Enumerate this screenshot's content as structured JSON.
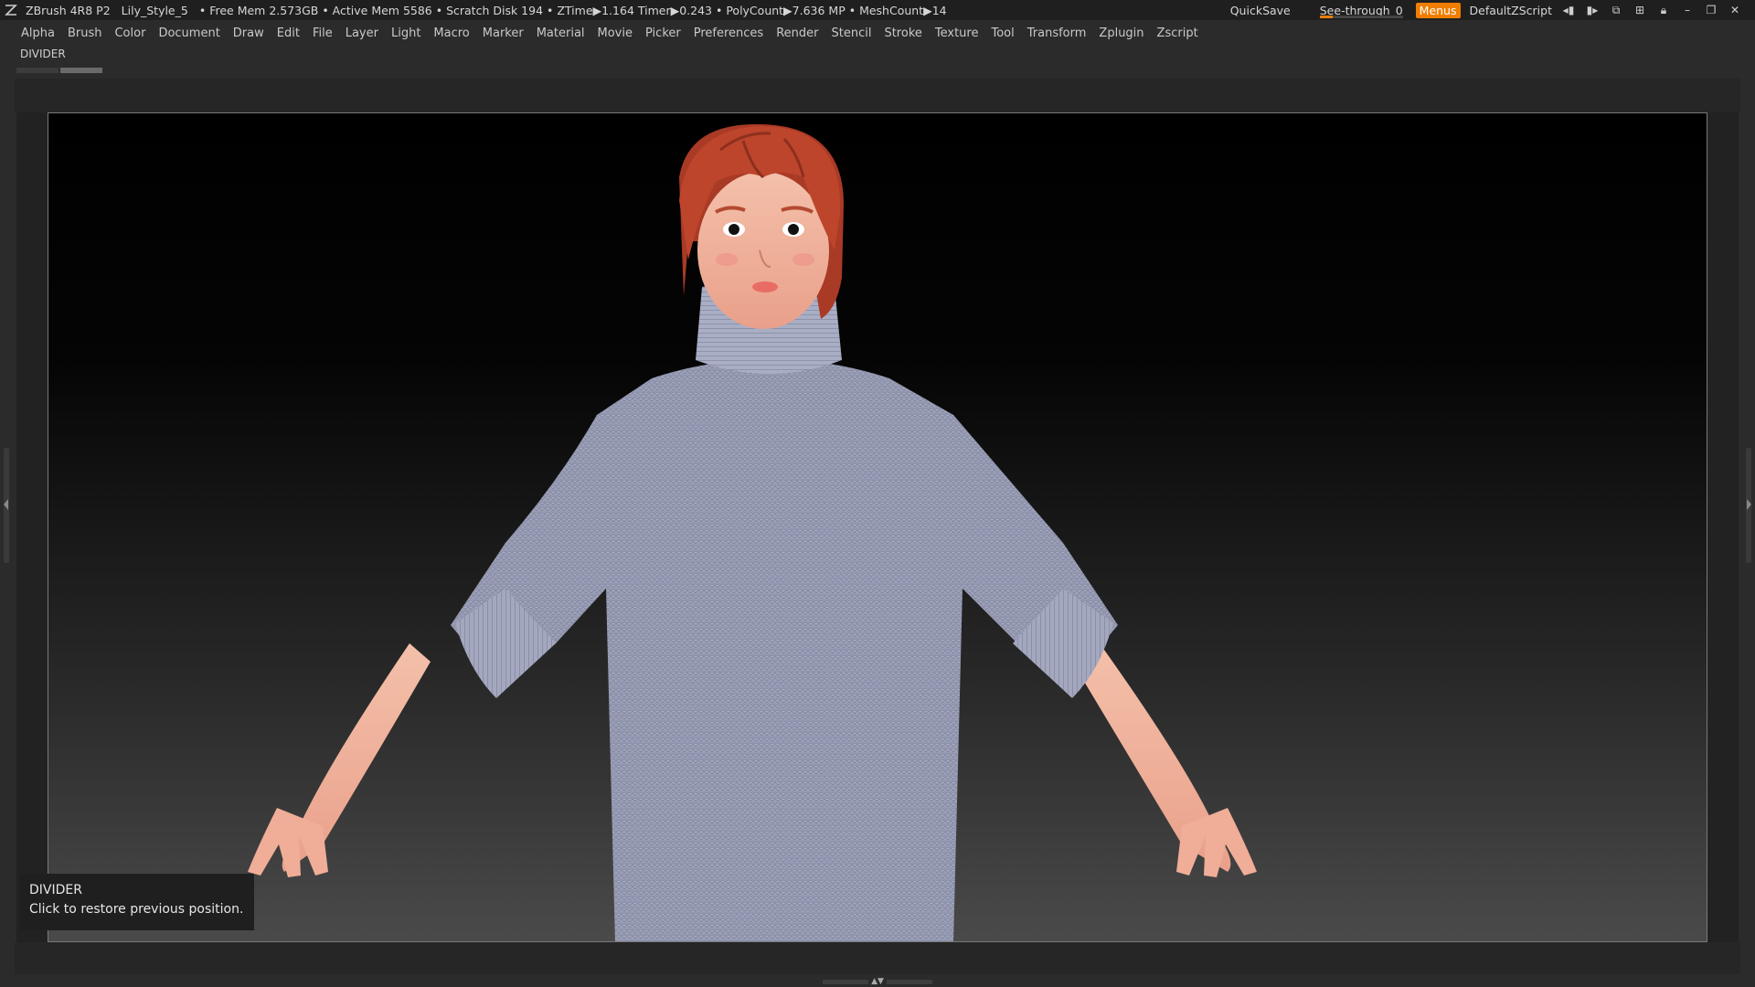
{
  "titlebar": {
    "app": "ZBrush 4R8 P2",
    "document": "Lily_Style_5",
    "stats": "• Free Mem 2.573GB • Active Mem 5586 • Scratch Disk 194 •  ZTime▶1.164 Timer▶0.243 • PolyCount▶7.636 MP  • MeshCount▶14",
    "quicksave": "QuickSave",
    "seethrough_label": "See-through",
    "seethrough_value": "0",
    "menus": "Menus",
    "zscript": "DefaultZScript"
  },
  "menubar": [
    "Alpha",
    "Brush",
    "Color",
    "Document",
    "Draw",
    "Edit",
    "File",
    "Layer",
    "Light",
    "Macro",
    "Marker",
    "Material",
    "Movie",
    "Picker",
    "Preferences",
    "Render",
    "Stencil",
    "Stroke",
    "Texture",
    "Tool",
    "Transform",
    "Zplugin",
    "Zscript"
  ],
  "divider_label": "DIVIDER",
  "tooltip": {
    "title": "DIVIDER",
    "body": "Click to restore previous position."
  },
  "colors": {
    "accent": "#f07d00",
    "sweater": "#9aa0b8",
    "hair": "#b6402a",
    "skin": "#f2b49e"
  }
}
